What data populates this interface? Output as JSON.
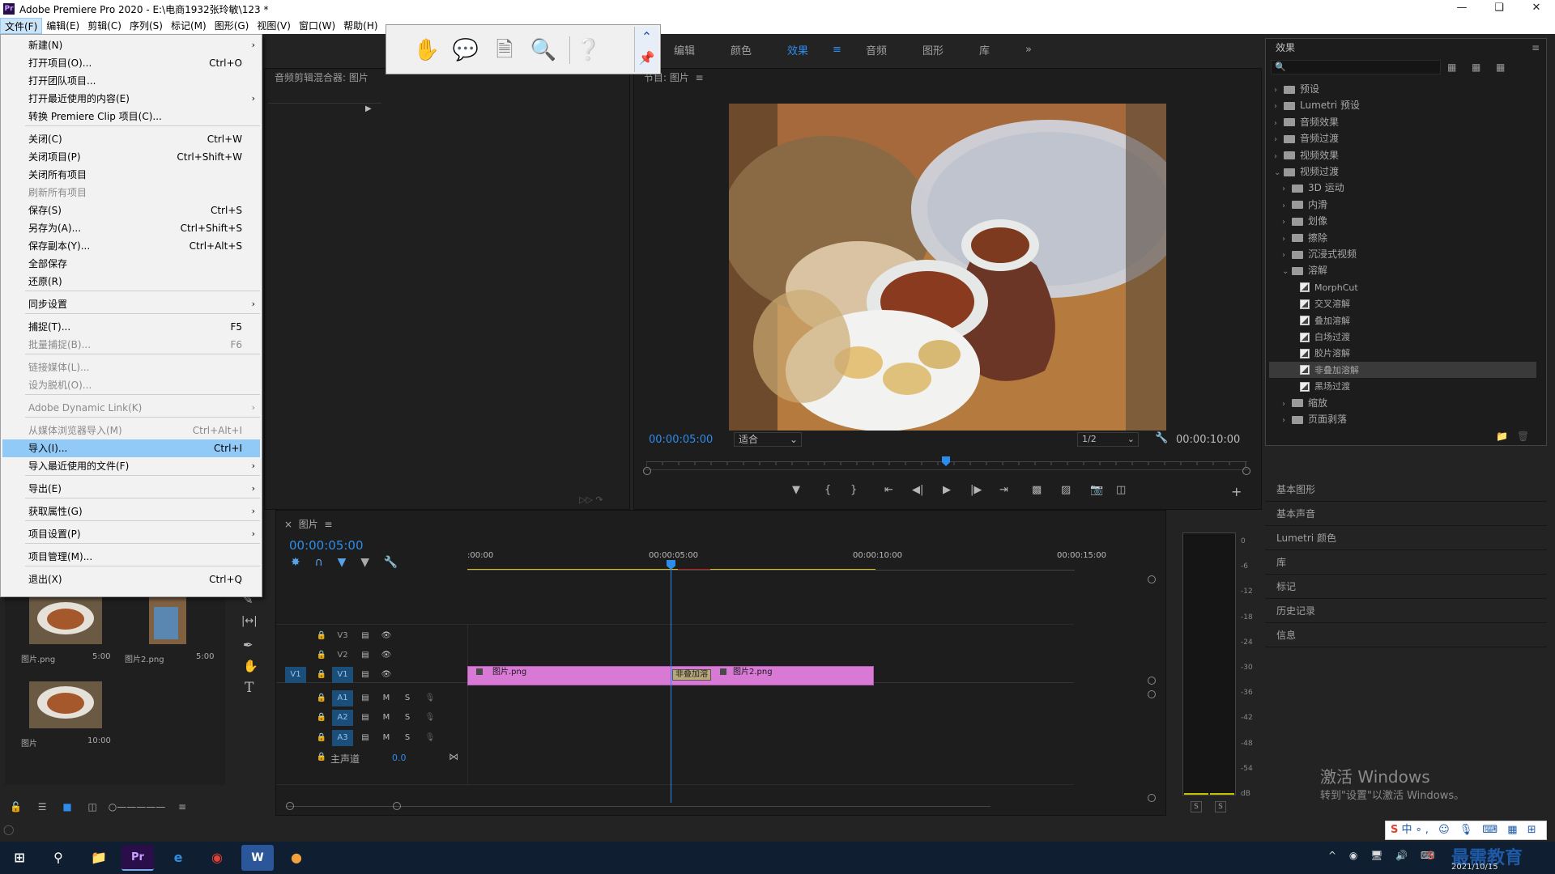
{
  "window": {
    "title": "Adobe Premiere Pro 2020 - E:\\电商1932张玲敏\\123 *",
    "app_icon": "Pr"
  },
  "menubar": [
    "文件(F)",
    "编辑(E)",
    "剪辑(C)",
    "序列(S)",
    "标记(M)",
    "图形(G)",
    "视图(V)",
    "窗口(W)",
    "帮助(H)"
  ],
  "file_menu": [
    {
      "label": "新建(N)",
      "shortcut": "",
      "sub": true,
      "disabled": false
    },
    {
      "label": "打开项目(O)...",
      "shortcut": "Ctrl+O",
      "sub": false,
      "disabled": false
    },
    {
      "label": "打开团队项目...",
      "shortcut": "",
      "sub": false,
      "disabled": false
    },
    {
      "label": "打开最近使用的内容(E)",
      "shortcut": "",
      "sub": true,
      "disabled": false
    },
    {
      "label": "转换 Premiere Clip 项目(C)...",
      "shortcut": "",
      "sub": false,
      "disabled": false
    },
    {
      "sep": true
    },
    {
      "label": "关闭(C)",
      "shortcut": "Ctrl+W",
      "sub": false,
      "disabled": false
    },
    {
      "label": "关闭项目(P)",
      "shortcut": "Ctrl+Shift+W",
      "sub": false,
      "disabled": false
    },
    {
      "label": "关闭所有项目",
      "shortcut": "",
      "sub": false,
      "disabled": false
    },
    {
      "label": "刷新所有项目",
      "shortcut": "",
      "sub": false,
      "disabled": true
    },
    {
      "label": "保存(S)",
      "shortcut": "Ctrl+S",
      "sub": false,
      "disabled": false
    },
    {
      "label": "另存为(A)...",
      "shortcut": "Ctrl+Shift+S",
      "sub": false,
      "disabled": false
    },
    {
      "label": "保存副本(Y)...",
      "shortcut": "Ctrl+Alt+S",
      "sub": false,
      "disabled": false
    },
    {
      "label": "全部保存",
      "shortcut": "",
      "sub": false,
      "disabled": false
    },
    {
      "label": "还原(R)",
      "shortcut": "",
      "sub": false,
      "disabled": false
    },
    {
      "sep": true
    },
    {
      "label": "同步设置",
      "shortcut": "",
      "sub": true,
      "disabled": false
    },
    {
      "sep": true
    },
    {
      "label": "捕捉(T)...",
      "shortcut": "F5",
      "sub": false,
      "disabled": false
    },
    {
      "label": "批量捕捉(B)...",
      "shortcut": "F6",
      "sub": false,
      "disabled": true
    },
    {
      "sep": true
    },
    {
      "label": "链接媒体(L)...",
      "shortcut": "",
      "sub": false,
      "disabled": true
    },
    {
      "label": "设为脱机(O)...",
      "shortcut": "",
      "sub": false,
      "disabled": true
    },
    {
      "sep": true
    },
    {
      "label": "Adobe Dynamic Link(K)",
      "shortcut": "",
      "sub": true,
      "disabled": true
    },
    {
      "sep": true
    },
    {
      "label": "从媒体浏览器导入(M)",
      "shortcut": "Ctrl+Alt+I",
      "sub": false,
      "disabled": true
    },
    {
      "label": "导入(I)...",
      "shortcut": "Ctrl+I",
      "sub": false,
      "disabled": false,
      "hover": true
    },
    {
      "label": "导入最近使用的文件(F)",
      "shortcut": "",
      "sub": true,
      "disabled": false
    },
    {
      "sep": true
    },
    {
      "label": "导出(E)",
      "shortcut": "",
      "sub": true,
      "disabled": false
    },
    {
      "sep": true
    },
    {
      "label": "获取属性(G)",
      "shortcut": "",
      "sub": true,
      "disabled": false
    },
    {
      "sep": true
    },
    {
      "label": "项目设置(P)",
      "shortcut": "",
      "sub": true,
      "disabled": false
    },
    {
      "sep": true
    },
    {
      "label": "项目管理(M)...",
      "shortcut": "",
      "sub": false,
      "disabled": false
    },
    {
      "sep": true
    },
    {
      "label": "退出(X)",
      "shortcut": "Ctrl+Q",
      "sub": false,
      "disabled": false
    }
  ],
  "workspaces": [
    "编辑",
    "颜色",
    "效果",
    "音频",
    "图形",
    "库"
  ],
  "workspace_selected": "效果",
  "source_panel": {
    "title": "音频剪辑混合器: 图片"
  },
  "program_monitor": {
    "title": "节目: 图片",
    "timecode_current": "00:00:05:00",
    "fit": "适合",
    "resolution": "1/2",
    "timecode_duration": "00:00:10:00"
  },
  "effects_panel": {
    "title": "效果",
    "tree": [
      {
        "label": "预设",
        "level": 0,
        "type": "folder",
        "expanded": false
      },
      {
        "label": "Lumetri 预设",
        "level": 0,
        "type": "folder",
        "expanded": false
      },
      {
        "label": "音频效果",
        "level": 0,
        "type": "folder",
        "expanded": false
      },
      {
        "label": "音频过渡",
        "level": 0,
        "type": "folder",
        "expanded": false
      },
      {
        "label": "视频效果",
        "level": 0,
        "type": "folder",
        "expanded": false
      },
      {
        "label": "视频过渡",
        "level": 0,
        "type": "folder",
        "expanded": true
      },
      {
        "label": "3D 运动",
        "level": 1,
        "type": "folder",
        "expanded": false
      },
      {
        "label": "内滑",
        "level": 1,
        "type": "folder",
        "expanded": false
      },
      {
        "label": "划像",
        "level": 1,
        "type": "folder",
        "expanded": false
      },
      {
        "label": "擦除",
        "level": 1,
        "type": "folder",
        "expanded": false
      },
      {
        "label": "沉浸式视频",
        "level": 1,
        "type": "folder",
        "expanded": false
      },
      {
        "label": "溶解",
        "level": 1,
        "type": "folder",
        "expanded": true
      },
      {
        "label": "MorphCut",
        "level": 2,
        "type": "fx"
      },
      {
        "label": "交叉溶解",
        "level": 2,
        "type": "fx"
      },
      {
        "label": "叠加溶解",
        "level": 2,
        "type": "fx"
      },
      {
        "label": "白场过渡",
        "level": 2,
        "type": "fx"
      },
      {
        "label": "胶片溶解",
        "level": 2,
        "type": "fx"
      },
      {
        "label": "非叠加溶解",
        "level": 2,
        "type": "fx",
        "highlight": true
      },
      {
        "label": "黑场过渡",
        "level": 2,
        "type": "fx"
      },
      {
        "label": "缩放",
        "level": 1,
        "type": "folder",
        "expanded": false
      },
      {
        "label": "页面剥落",
        "level": 1,
        "type": "folder",
        "expanded": false
      }
    ]
  },
  "side_panels": [
    "基本图形",
    "基本声音",
    "Lumetri 颜色",
    "库",
    "标记",
    "历史记录",
    "信息"
  ],
  "timeline": {
    "tab": "图片",
    "timecode": "00:00:05:00",
    "ruler": [
      ":00:00",
      "00:00:05:00",
      "00:00:10:00",
      "00:00:15:00"
    ],
    "video_tracks": [
      "V3",
      "V2",
      "V1"
    ],
    "audio_tracks": [
      "A1",
      "A2",
      "A3"
    ],
    "source_patch": "V1",
    "master_label": "主声道",
    "master_value": "0.0",
    "clips": [
      {
        "name": "图片.png"
      },
      {
        "name": "图片2.png"
      }
    ],
    "transition_label": "非叠加溶",
    "mute": "M",
    "solo": "S"
  },
  "meter": {
    "scale": [
      "0",
      "-6",
      "-12",
      "-18",
      "-24",
      "-30",
      "-36",
      "-42",
      "-48",
      "-54",
      "dB"
    ],
    "solo_left": "S",
    "solo_right": "S"
  },
  "project": {
    "items": [
      {
        "name": "图片.png",
        "duration": "5:00"
      },
      {
        "name": "图片2.png",
        "duration": "5:00"
      },
      {
        "name": "图片",
        "duration": "10:00"
      }
    ]
  },
  "watermark": {
    "line1": "激活 Windows",
    "line2": "转到\"设置\"以激活 Windows。"
  },
  "taskbar": {
    "date": "2021/10/15",
    "brand": "最需教育",
    "ime": "中"
  }
}
